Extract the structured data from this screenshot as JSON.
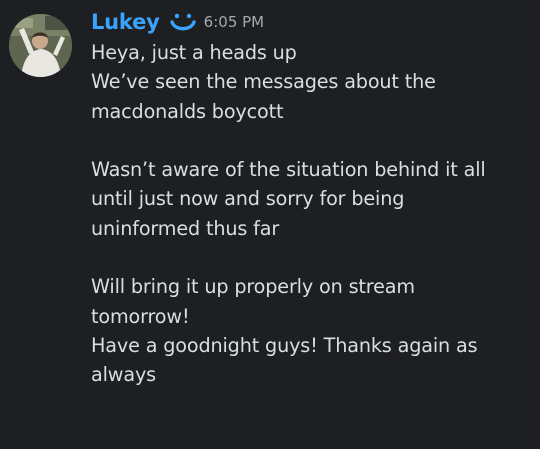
{
  "message": {
    "username": "Lukey",
    "timestamp": "6:05 PM",
    "badge_icon": "smile-icon",
    "lines": [
      "Heya, just a heads up",
      "We’ve seen the messages about the",
      "macdonalds boycott",
      "",
      "Wasn’t aware of the situation behind it all",
      "until just now and sorry for being",
      "uninformed thus far",
      "",
      "Will bring it up properly on stream",
      "tomorrow!",
      "Have a goodnight guys! Thanks again as",
      "always"
    ]
  },
  "colors": {
    "background": "#1e1f22",
    "username": "#3aa2ff",
    "text": "#dbdee1",
    "timestamp": "#a5a8ad"
  }
}
